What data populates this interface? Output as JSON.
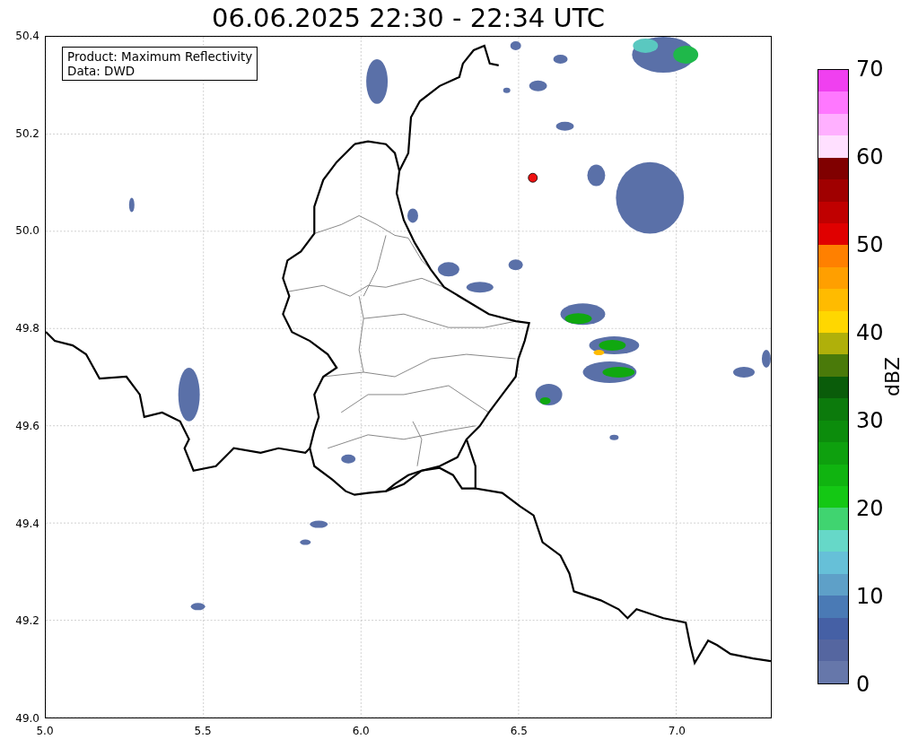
{
  "title": "06.06.2025 22:30 - 22:34 UTC",
  "info_box": {
    "lines": [
      "Product: Maximum Reflectivity",
      "Data: DWD"
    ]
  },
  "map": {
    "x_ticks": [
      "5.0",
      "5.5",
      "6.0",
      "6.5",
      "7.0"
    ],
    "y_ticks": [
      "50.4",
      "50.2",
      "50.0",
      "49.8",
      "49.6",
      "49.4",
      "49.2",
      "49.0"
    ]
  },
  "colorbar": {
    "label": "dBZ",
    "ticks": [
      "70",
      "60",
      "50",
      "40",
      "30",
      "20",
      "10",
      "0"
    ],
    "bands": [
      {
        "color": "#f040f0"
      },
      {
        "color": "#ff78ff"
      },
      {
        "color": "#ffb0ff"
      },
      {
        "color": "#ffe0ff"
      },
      {
        "color": "#800000"
      },
      {
        "color": "#a00000"
      },
      {
        "color": "#c00000"
      },
      {
        "color": "#e00000"
      },
      {
        "color": "#ff8000"
      },
      {
        "color": "#ff9f00"
      },
      {
        "color": "#ffbb00"
      },
      {
        "color": "#ffd700"
      },
      {
        "color": "#b0b00a"
      },
      {
        "color": "#4a7a0a"
      },
      {
        "color": "#0a5c0a"
      },
      {
        "color": "#0c7a0c"
      },
      {
        "color": "#0c8c0c"
      },
      {
        "color": "#0ea00e"
      },
      {
        "color": "#10b410"
      },
      {
        "color": "#14c814"
      },
      {
        "color": "#40d470"
      },
      {
        "color": "#66d8c8"
      },
      {
        "color": "#66c0d8"
      },
      {
        "color": "#5ea0c8"
      },
      {
        "color": "#4a7ab5"
      },
      {
        "color": "#4560a5"
      },
      {
        "color": "#5566a0"
      },
      {
        "color": "#6677aa"
      }
    ]
  }
}
